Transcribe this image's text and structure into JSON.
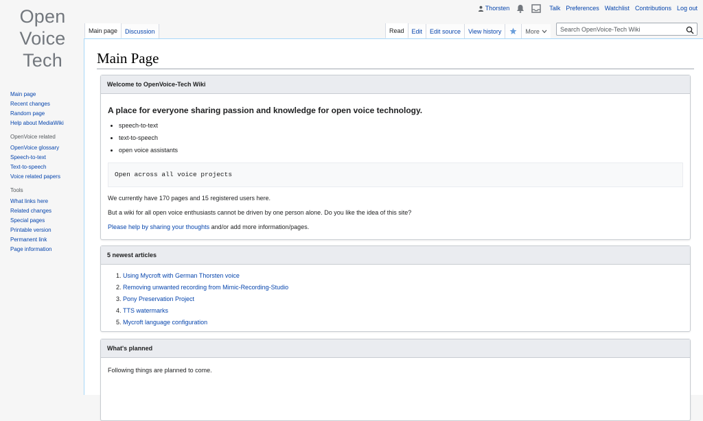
{
  "logo": {
    "lines": [
      "Open",
      "Voice",
      "Tech"
    ]
  },
  "personal_tools": {
    "user": "Thorsten",
    "links": [
      "Talk",
      "Preferences",
      "Watchlist",
      "Contributions",
      "Log out"
    ]
  },
  "tabs": {
    "left": [
      "Main page",
      "Discussion"
    ],
    "right": [
      "Read",
      "Edit",
      "Edit source",
      "View history"
    ],
    "more": "More"
  },
  "search": {
    "placeholder": "Search OpenVoice-Tech Wiki"
  },
  "sidebar": {
    "navigation": [
      "Main page",
      "Recent changes",
      "Random page",
      "Help about MediaWiki"
    ],
    "openvoice": {
      "title": "OpenVoice related",
      "items": [
        "OpenVoice glossary",
        "Speech-to-text",
        "Text-to-speech",
        "Voice related papers"
      ]
    },
    "tools": {
      "title": "Tools",
      "items": [
        "What links here",
        "Related changes",
        "Special pages",
        "Printable version",
        "Permanent link",
        "Page information"
      ]
    }
  },
  "page": {
    "title": "Main Page",
    "welcome": {
      "heading": "Welcome to OpenVoice-Tech Wiki",
      "tagline": "A place for everyone sharing passion and knowledge for open voice technology.",
      "bullets": [
        "speech-to-text",
        "text-to-speech",
        "open voice assistants"
      ],
      "code": "Open across all voice projects",
      "stats": "We currently have 170 pages and 15 registered users here.",
      "question": "But a wiki for all open voice enthusiasts cannot be driven by one person alone. Do you like the idea of this site?",
      "help_link": "Please help by sharing your thoughts",
      "help_rest": " and/or add more information/pages."
    },
    "newest": {
      "heading": "5 newest articles",
      "articles": [
        "Using Mycroft with German Thorsten voice",
        "Removing unwanted recording from Mimic-Recording-Studio",
        "Pony Preservation Project",
        "TTS watermarks",
        "Mycroft language configuration"
      ]
    },
    "planned": {
      "heading": "What's planned",
      "intro": "Following things are planned to come."
    }
  },
  "colors": {
    "link": "#0645ad",
    "box_header": "#eaecf0",
    "border": "#c8ccd1"
  }
}
